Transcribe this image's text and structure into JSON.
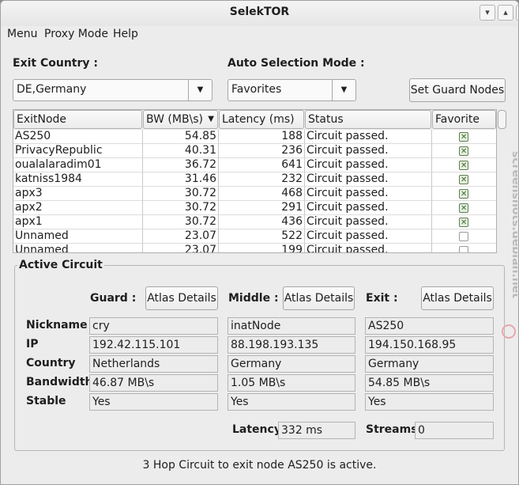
{
  "window": {
    "title": "SelekTOR",
    "minimize": "▾",
    "maximize": "▴",
    "close": "✕"
  },
  "menubar": {
    "menu": "Menu",
    "proxy_mode": "Proxy Mode",
    "help": "Help"
  },
  "exit_country": {
    "label": "Exit Country :",
    "value": "DE,Germany",
    "arrow": "▼"
  },
  "auto_selection": {
    "label": "Auto Selection Mode :",
    "value": "Favorites",
    "arrow": "▼"
  },
  "set_guard_nodes": "Set Guard Nodes",
  "table": {
    "headers": {
      "exitnode": "ExitNode",
      "bw": "BW (MB\\s)",
      "bw_sort": "▼",
      "latency": "Latency (ms)",
      "status": "Status",
      "favorite": "Favorite"
    },
    "rows": [
      {
        "node": "AS250",
        "bw": "54.85",
        "latency": "188",
        "status": "Circuit passed.",
        "favorite": true
      },
      {
        "node": "PrivacyRepublic",
        "bw": "40.31",
        "latency": "236",
        "status": "Circuit passed.",
        "favorite": true
      },
      {
        "node": "oualalaradim01",
        "bw": "36.72",
        "latency": "641",
        "status": "Circuit passed.",
        "favorite": true
      },
      {
        "node": "katniss1984",
        "bw": "31.46",
        "latency": "232",
        "status": "Circuit passed.",
        "favorite": true
      },
      {
        "node": "apx3",
        "bw": "30.72",
        "latency": "468",
        "status": "Circuit passed.",
        "favorite": true
      },
      {
        "node": "apx2",
        "bw": "30.72",
        "latency": "291",
        "status": "Circuit passed.",
        "favorite": true
      },
      {
        "node": "apx1",
        "bw": "30.72",
        "latency": "436",
        "status": "Circuit passed.",
        "favorite": true
      },
      {
        "node": "Unnamed",
        "bw": "23.07",
        "latency": "522",
        "status": "Circuit passed.",
        "favorite": false
      },
      {
        "node": "Unnamed",
        "bw": "23.07",
        "latency": "199",
        "status": "Circuit passed.",
        "favorite": false
      }
    ]
  },
  "circuit": {
    "title": "Active Circuit",
    "guard_label": "Guard :",
    "middle_label": "Middle :",
    "exit_label": "Exit :",
    "atlas": "Atlas Details",
    "row_labels": {
      "nickname": "Nickname",
      "ip": "IP",
      "country": "Country",
      "bandwidth": "Bandwidth",
      "stable": "Stable"
    },
    "guard": {
      "nickname": "cry",
      "ip": "192.42.115.101",
      "country": "Netherlands",
      "bandwidth": "46.87 MB\\s",
      "stable": "Yes"
    },
    "middle": {
      "nickname": "inatNode",
      "ip": "88.198.193.135",
      "country": "Germany",
      "bandwidth": "1.05 MB\\s",
      "stable": "Yes"
    },
    "exit": {
      "nickname": "AS250",
      "ip": "194.150.168.95",
      "country": "Germany",
      "bandwidth": "54.85 MB\\s",
      "stable": "Yes"
    },
    "latency_label": "Latency",
    "latency_value": "332 ms",
    "streams_label": "Streams",
    "streams_value": "0"
  },
  "status_text": "3 Hop Circuit to exit node AS250 is active.",
  "watermark": "screenshots.debian.net"
}
